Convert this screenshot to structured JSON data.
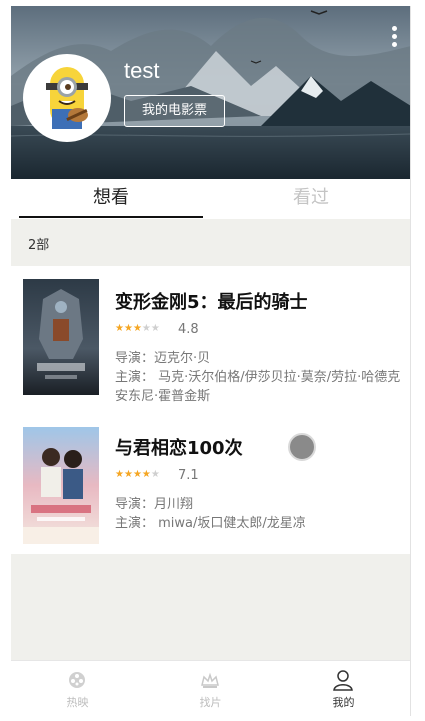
{
  "header": {
    "username": "test",
    "ticket_button": "我的电影票"
  },
  "tabs": [
    {
      "label": "想看",
      "active": true
    },
    {
      "label": "看过",
      "active": false
    }
  ],
  "list_count": "2部",
  "movies": [
    {
      "title": "变形金刚5：最后的骑士",
      "rating": 4.8,
      "stars": 2.5,
      "director": "导演：迈克尔·贝",
      "cast": "主演： 马克·沃尔伯格/伊莎贝拉·莫奈/劳拉·哈德克安东尼·霍普金斯"
    },
    {
      "title": "与君相恋100次",
      "rating": 7.1,
      "stars": 3.5,
      "director": "导演：月川翔",
      "cast": "主演： miwa/坂口健太郎/龙星凉"
    }
  ],
  "bottom_nav": [
    {
      "label": "热映",
      "icon": "film-reel-icon",
      "active": false
    },
    {
      "label": "找片",
      "icon": "crown-icon",
      "active": false
    },
    {
      "label": "我的",
      "icon": "person-icon",
      "active": true
    }
  ],
  "colors": {
    "star_on": "#f5a623",
    "star_off": "#cfcfcf",
    "background": "#f0f0ec"
  }
}
